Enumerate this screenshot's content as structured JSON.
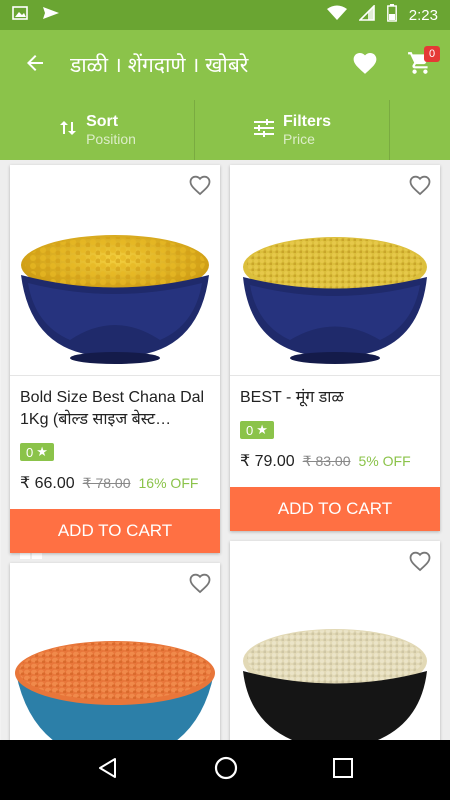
{
  "status_bar": {
    "time": "2:23"
  },
  "app_bar": {
    "title": "डाळी । शेंगदाणे । खोबरे",
    "cart_count": "0"
  },
  "filter_bar": {
    "sort_label": "Sort",
    "sort_value": "Position",
    "filter_label": "Filters",
    "filter_value": "Price"
  },
  "products": [
    {
      "name": "Bold Size Best Chana Dal 1Kg (बोल्ड साइज बेस्ट…",
      "rating": "0",
      "price": "₹ 66.00",
      "mrp": "₹ 78.00",
      "discount": "16% OFF",
      "button": "ADD TO CART"
    },
    {
      "name": "BEST - मूंग डाळ",
      "rating": "0",
      "price": "₹ 79.00",
      "mrp": "₹ 83.00",
      "discount": "5% OFF",
      "button": "ADD TO CART"
    }
  ],
  "colors": {
    "primary": "#8bc34a",
    "status": "#6aa532",
    "accent": "#ff7043",
    "badge": "#e53935"
  },
  "icons": [
    "image-icon",
    "send-icon",
    "wifi-icon",
    "signal-icon",
    "battery-icon",
    "back-arrow-icon",
    "heart-icon",
    "cart-icon",
    "sort-icon",
    "filter-icon",
    "grid-view-icon",
    "wishlist-heart-icon",
    "star-icon",
    "nav-back-icon",
    "nav-home-icon",
    "nav-recents-icon"
  ]
}
